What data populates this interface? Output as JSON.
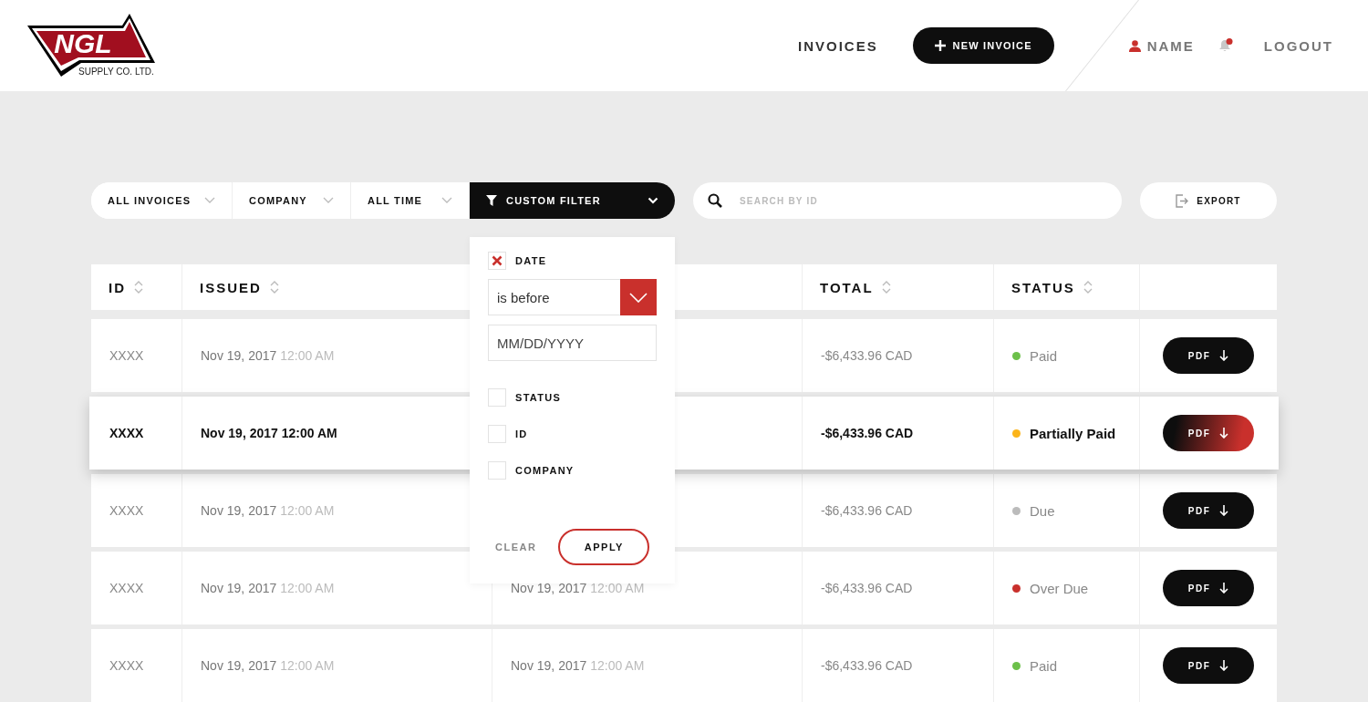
{
  "header": {
    "logo": {
      "mark": "NGL",
      "subtitle": "SUPPLY CO. LTD."
    },
    "nav": [
      {
        "label": "INVOICES"
      }
    ],
    "new_invoice_button": "NEW INVOICE",
    "user": "NAME",
    "notifications": {
      "unread": true
    },
    "logout": "LOGOUT"
  },
  "filters": [
    {
      "label": "ALL INVOICES",
      "kind": "dropdown",
      "selected": false
    },
    {
      "label": "COMPANY",
      "kind": "dropdown",
      "selected": false
    },
    {
      "label": "ALL TIME",
      "kind": "dropdown",
      "selected": false
    },
    {
      "label": "CUSTOM FILTER",
      "kind": "custom",
      "selected": true
    }
  ],
  "search": {
    "placeholder": "SEARCH BY ID"
  },
  "export_button": "EXPORT",
  "custom_filter_panel": {
    "options": [
      {
        "label": "DATE",
        "checked": true,
        "condition": "is before",
        "placeholder": "MM/DD/YYYY"
      },
      {
        "label": "STATUS",
        "checked": false
      },
      {
        "label": "ID",
        "checked": false
      },
      {
        "label": "COMPANY",
        "checked": false
      }
    ],
    "clear_button": "CLEAR",
    "apply_button": "APPLY"
  },
  "table": {
    "columns": [
      {
        "label": "ID",
        "sortable": true
      },
      {
        "label": "ISSUED",
        "sortable": true
      },
      {
        "label": "TOTAL",
        "sortable": true
      },
      {
        "label": "STATUS",
        "sortable": true
      }
    ],
    "rows": [
      {
        "id": "XXXX",
        "issued_date": "Nov 19, 2017",
        "issued_time": "12:00 AM",
        "total": "-$6,433.96 CAD",
        "status": "Paid",
        "color": "#6cc04a",
        "selected": false,
        "pdf": "PDF"
      },
      {
        "id": "XXXX",
        "issued_date": "Nov 19, 2017",
        "issued_time": "12:00 AM",
        "total": "-$6,433.96 CAD",
        "status": "Partially Paid",
        "color": "#fbb41a",
        "selected": true,
        "pdf": "PDF"
      },
      {
        "id": "XXXX",
        "issued_date": "Nov 19, 2017",
        "issued_time": "12:00 AM",
        "total": "-$6,433.96 CAD",
        "status": "Due",
        "color": "#bbbbbb",
        "selected": false,
        "pdf": "PDF"
      },
      {
        "id": "XXXX",
        "issued_date": "Nov 19, 2017",
        "issued_time": "12:00 AM",
        "column_3_date": "Nov 19, 2017",
        "column_3_time": "12:00 AM",
        "total": "-$6,433.96 CAD",
        "status": "Over Due",
        "color": "#c9302c",
        "selected": false,
        "pdf": "PDF"
      },
      {
        "id": "XXXX",
        "issued_date": "Nov 19, 2017",
        "issued_time": "12:00 AM",
        "column_3_date": "Nov 19, 2017",
        "column_3_time": "12:00 AM",
        "total": "-$6,433.96 CAD",
        "status": "Paid",
        "color": "#6cc04a",
        "selected": false,
        "pdf": "PDF"
      }
    ]
  }
}
